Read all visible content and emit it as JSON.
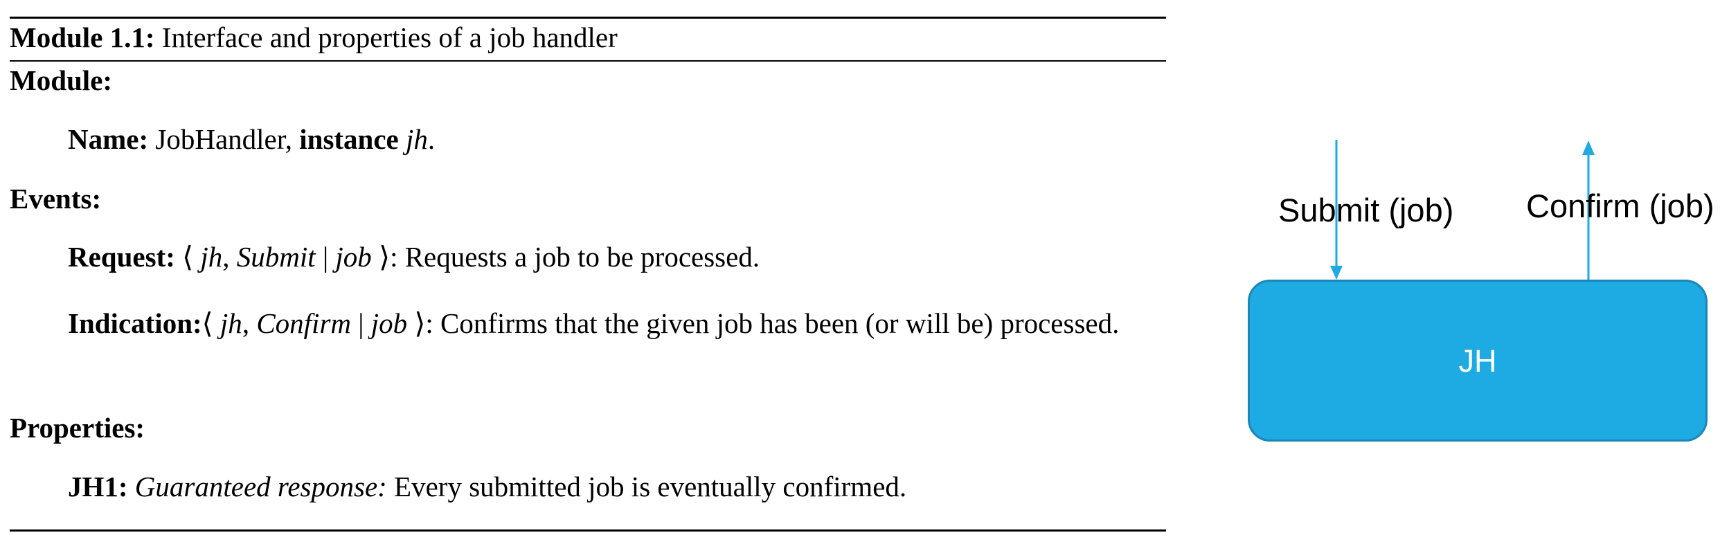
{
  "module": {
    "title_prefix": "Module 1.1:",
    "title_text": "Interface and properties of a job handler",
    "module_heading": "Module:",
    "name_label": "Name:",
    "name_value": "JobHandler,",
    "instance_label": "instance",
    "instance_value": "jh",
    "period": "."
  },
  "events": {
    "heading": "Events:",
    "request": {
      "label": "Request:",
      "open": "⟨",
      "id": "jh",
      "comma": ",",
      "event": "Submit",
      "bar": "|",
      "param": "job",
      "close": "⟩",
      "description": ": Requests a job to be processed."
    },
    "indication": {
      "label": "Indication:",
      "open": "⟨",
      "id": "jh",
      "comma": ",",
      "event": "Confirm",
      "bar": "|",
      "param": "job",
      "close": "⟩",
      "description": ": Confirms that the given job has been (or will be) processed."
    }
  },
  "properties": {
    "heading": "Properties:",
    "items": [
      {
        "label": "JH1:",
        "name": "Guaranteed response:",
        "description": "Every submitted job is eventually confirmed."
      }
    ]
  },
  "diagram": {
    "submit_label": "Submit (job)",
    "confirm_label": "Confirm (job)",
    "box_label": "JH",
    "colors": {
      "box_fill": "#1eaae2",
      "box_border": "#1b87b8",
      "arrow": "#1eaae2",
      "box_text": "#ffffff"
    }
  }
}
